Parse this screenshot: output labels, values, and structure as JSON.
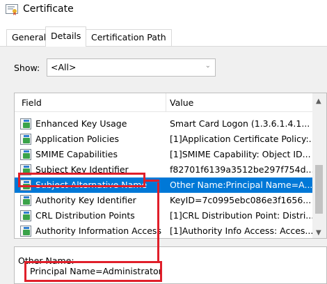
{
  "window": {
    "title": "Certificate"
  },
  "tabs": [
    {
      "label": "General",
      "active": false
    },
    {
      "label": "Details",
      "active": true
    },
    {
      "label": "Certification Path",
      "active": false
    }
  ],
  "show": {
    "label": "Show:",
    "selected": "<All>"
  },
  "list": {
    "columns": {
      "field": "Field",
      "value": "Value"
    },
    "rows": [
      {
        "field": "Enhanced Key Usage",
        "value": "Smart Card Logon (1.3.6.1.4.1..."
      },
      {
        "field": "Application Policies",
        "value": "[1]Application Certificate Policy:..."
      },
      {
        "field": "SMIME Capabilities",
        "value": "[1]SMIME Capability: Object ID..."
      },
      {
        "field": "Subject Key Identifier",
        "value": "f82701f6139a3512be297f754d..."
      },
      {
        "field": "Subject Alternative Name",
        "value": "Other Name:Principal Name=A..."
      },
      {
        "field": "Authority Key Identifier",
        "value": "KeyID=7c0995ebc086e3f1656..."
      },
      {
        "field": "CRL Distribution Points",
        "value": "[1]CRL Distribution Point: Distri..."
      },
      {
        "field": "Authority Information Access",
        "value": "[1]Authority Info Access: Acces..."
      }
    ],
    "selected_index": 4
  },
  "detail": {
    "line1": "Other Name:",
    "line2": "Principal Name=Administrator"
  },
  "colors": {
    "selection": "#0078d7",
    "highlight_annotation": "#e01f2a"
  }
}
